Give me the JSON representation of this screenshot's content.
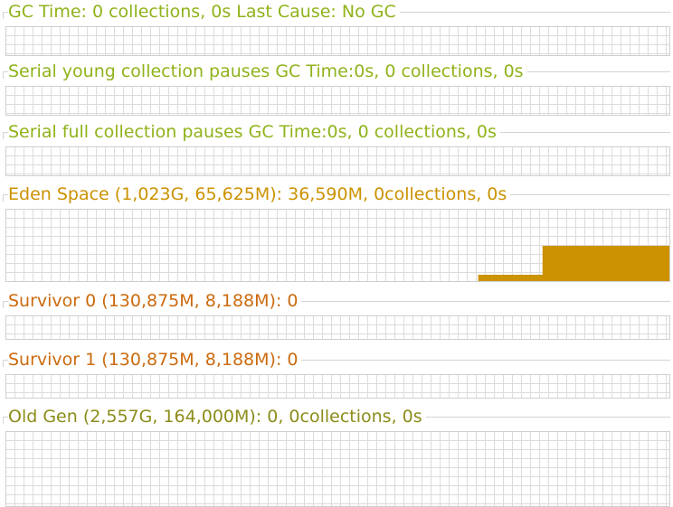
{
  "panels": {
    "gc_time": {
      "title": "GC Time: 0 collections, 0s Last Cause: No GC",
      "color": "#8fb31a"
    },
    "serial_young": {
      "title": "Serial young collection pauses GC Time:0s, 0 collections, 0s",
      "color": "#8fb31a"
    },
    "serial_full": {
      "title": "Serial full collection pauses GC Time:0s, 0 collections, 0s",
      "color": "#8fb31a"
    },
    "eden": {
      "title": "Eden Space (1,023G, 65,625M): 36,590M, 0collections, 0s",
      "color": "#cc9200"
    },
    "survivor0": {
      "title": "Survivor 0 (130,875M, 8,188M): 0",
      "color": "#cc6a0e"
    },
    "survivor1": {
      "title": "Survivor 1 (130,875M, 8,188M): 0",
      "color": "#cc6a0e"
    },
    "old_gen": {
      "title": "Old Gen (2,557G, 164,000M): 0, 0collections, 0s",
      "color": "#8c8c1a"
    }
  },
  "chart_data": {
    "type": "area",
    "series": [
      {
        "fill": "#cc9200",
        "values": [
          0,
          0,
          0,
          0,
          0,
          0,
          0,
          0,
          0,
          0,
          0,
          0,
          0,
          0,
          0,
          0,
          0,
          0,
          0,
          0,
          0,
          0,
          0.1,
          0.1,
          0.1,
          0.5,
          0.5,
          0.5,
          0.5,
          0.5,
          0.5
        ]
      }
    ],
    "ylim": [
      0,
      1
    ]
  }
}
